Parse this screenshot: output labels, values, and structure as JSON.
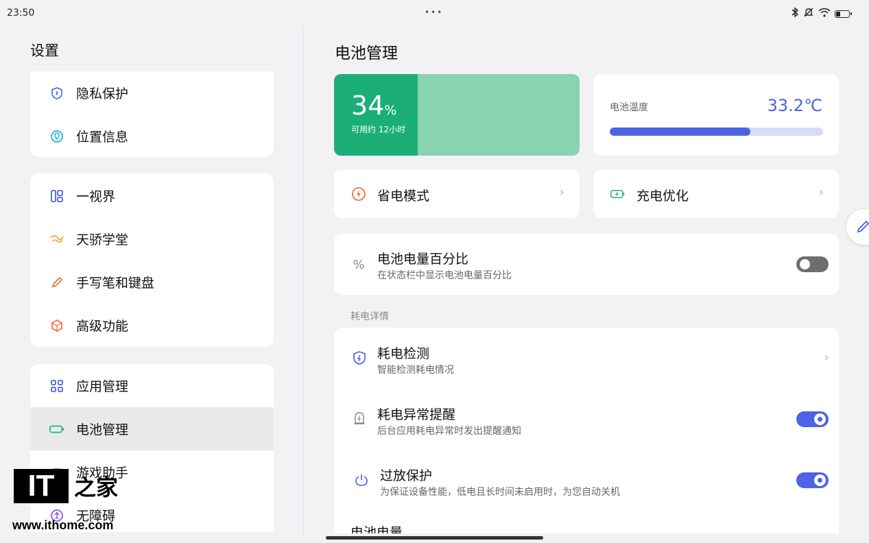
{
  "status_bar": {
    "time": "23:50",
    "center_dots": "•••",
    "icons": [
      "bluetooth-icon",
      "mute-icon",
      "wifi-icon",
      "battery-icon"
    ],
    "battery_level_fraction": 0.34
  },
  "sidebar": {
    "title": "设置",
    "group1": [
      {
        "label": "隐私保护",
        "icon": "privacy-shield-icon"
      },
      {
        "label": "位置信息",
        "icon": "location-icon"
      }
    ],
    "group2": [
      {
        "label": "一视界",
        "icon": "multi-window-icon"
      },
      {
        "label": "天骄学堂",
        "icon": "tianjiao-icon"
      },
      {
        "label": "手写笔和键盘",
        "icon": "pen-icon"
      },
      {
        "label": "高级功能",
        "icon": "advanced-icon"
      }
    ],
    "group3": [
      {
        "label": "应用管理",
        "icon": "apps-grid-icon"
      },
      {
        "label": "电池管理",
        "icon": "battery-icon",
        "active": true
      },
      {
        "label": "游戏助手",
        "icon": "game-icon"
      },
      {
        "label": "无障碍",
        "icon": "accessibility-icon"
      }
    ]
  },
  "main": {
    "title": "电池管理",
    "battery": {
      "percent_value": "34",
      "percent_unit": "%",
      "level_fraction": 0.34,
      "remaining": "可用约 12小时"
    },
    "temperature": {
      "label": "电池温度",
      "value": "33.2℃",
      "bar_fraction": 0.66
    },
    "power_saving": {
      "label": "省电模式",
      "icon": "power-saving-icon"
    },
    "charge_optimize": {
      "label": "充电优化",
      "icon": "charging-icon"
    },
    "percentage": {
      "icon_glyph": "%",
      "title": "电池电量百分比",
      "subtitle": "在状态栏中显示电池电量百分比",
      "enabled": false
    },
    "section_label": "耗电详情",
    "details": [
      {
        "title": "耗电检测",
        "subtitle": "智能检测耗电情况",
        "control": "chevron"
      },
      {
        "title": "耗电异常提醒",
        "subtitle": "后台应用耗电异常时发出提醒通知",
        "control": "toggle",
        "enabled": true
      },
      {
        "title": "过放保护",
        "subtitle": "为保证设备性能，低电且长时间未启用时，为您自动关机",
        "control": "toggle",
        "enabled": true
      },
      {
        "title": "电池电量"
      }
    ],
    "chevron_glyph": "›"
  },
  "watermark": {
    "logo_text": "IT",
    "logo_cn": "之家",
    "url": "www.ithome.com"
  },
  "colors": {
    "battery_fill": "#1baf77",
    "battery_bg": "#88d3b1",
    "accent": "#4b63e4"
  }
}
